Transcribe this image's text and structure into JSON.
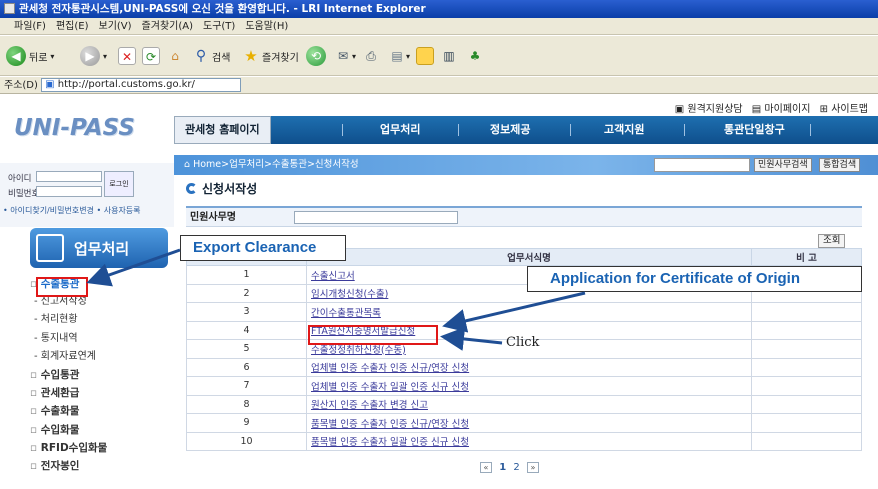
{
  "window": {
    "title": "관세청 전자통관시스템,UNI-PASS에 오신 것을 환영합니다. - LRI Internet Explorer"
  },
  "menubar": [
    "파일(F)",
    "편집(E)",
    "보기(V)",
    "즐겨찾기(A)",
    "도구(T)",
    "도움말(H)"
  ],
  "toolbar": {
    "back": "뒤로",
    "search": "검색",
    "favorites": "즐겨찾기"
  },
  "address": {
    "label": "주소(D)",
    "url": "http://portal.customs.go.kr/"
  },
  "top_links": [
    "원격지원상담",
    "마이페이지",
    "사이트맵"
  ],
  "logo": "UNI-PASS",
  "nav": {
    "home": "관세청 홈페이지",
    "items": [
      "업무처리",
      "정보제공",
      "고객지원",
      "통관단일창구"
    ]
  },
  "login": {
    "id_label": "아이디",
    "pw_label": "비밀번호",
    "button": "로그인",
    "links": "• 아이디찾기/비밀번호변경 • 사용자등록"
  },
  "side": {
    "title": "업무처리",
    "menu": [
      {
        "label": "수출통관",
        "type": "main-active"
      },
      {
        "label": "- 신고서작성",
        "type": "sub"
      },
      {
        "label": "- 처리현황",
        "type": "sub"
      },
      {
        "label": "- 통지내역",
        "type": "sub"
      },
      {
        "label": "- 회계자료연계",
        "type": "sub"
      },
      {
        "label": "수입통관",
        "type": "main"
      },
      {
        "label": "관세환급",
        "type": "main"
      },
      {
        "label": "수출화물",
        "type": "main"
      },
      {
        "label": "수입화물",
        "type": "main"
      },
      {
        "label": "RFID수입화물",
        "type": "main"
      },
      {
        "label": "전자봉인",
        "type": "main"
      }
    ]
  },
  "breadcrumb": "Home>업무처리>수출통관>신청서작성",
  "search_buttons": [
    "민원사무검색",
    "통합검색"
  ],
  "page": {
    "title": "신청서작성",
    "form_label": "민원사무명",
    "search_button": "조회"
  },
  "table": {
    "headers": [
      "",
      "업무서식명",
      "비 고"
    ],
    "rows": [
      {
        "no": "1",
        "name": "수출신고서"
      },
      {
        "no": "2",
        "name": "임시개청신청(수출)"
      },
      {
        "no": "3",
        "name": "간이수출통관목록"
      },
      {
        "no": "4",
        "name": "FTA원산지증명서발급신청"
      },
      {
        "no": "5",
        "name": "수출정정취하신청(수동)"
      },
      {
        "no": "6",
        "name": "업체별 인증 수출자 인증 신규/연장 신청"
      },
      {
        "no": "7",
        "name": "업체별 인증 수출자 일괄 인증 신규 신청"
      },
      {
        "no": "8",
        "name": "원산지 인증 수출자 변경 신고"
      },
      {
        "no": "9",
        "name": "품목별 인증 수출자 인증 신규/연장 신청"
      },
      {
        "no": "10",
        "name": "품목별 인증 수출자 일괄 인증 신규 신청"
      }
    ]
  },
  "pagination": {
    "pages": [
      "1",
      "2"
    ]
  },
  "annotations": {
    "export_clearance": "Export Clearance",
    "application": "Application for Certificate of Origin",
    "click": "Click"
  }
}
